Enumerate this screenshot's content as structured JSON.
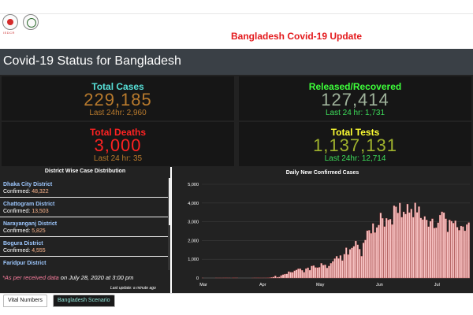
{
  "header": {
    "site_title": "Bangladesh Covid-19 Update",
    "logo_caption": "IEDCR"
  },
  "dashboard": {
    "title": "Covid-19 Status for Bangladesh"
  },
  "stats": {
    "total_cases": {
      "label": "Total Cases",
      "value": "229,185",
      "sub": "Last 24hr: 2,960",
      "label_color": "#57e0d8",
      "value_color": "#b87a2d",
      "sub_color": "#b87a2d"
    },
    "recovered": {
      "label": "Released/Recovered",
      "value": "127,414",
      "sub": "Last 24 hr: 1,731",
      "label_color": "#3dff3a",
      "value_color": "#9fb29b",
      "sub_color": "#3ddc5a"
    },
    "deaths": {
      "label": "Total Deaths",
      "value": "3,000",
      "sub": "Last 24 hr: 35",
      "label_color": "#ff2222",
      "value_color": "#ff2222",
      "sub_color": "#b87a2d"
    },
    "tests": {
      "label": "Total Tests",
      "value": "1,137,131",
      "sub": "Last 24hr: 12,714",
      "label_color": "#ffff33",
      "value_color": "#9fb22d",
      "sub_color": "#3ddc5a"
    }
  },
  "districts": {
    "title": "District Wise Case Distribution",
    "items": [
      {
        "name": "Dhaka City District",
        "confirmed_label": "Confirmed:",
        "confirmed": "48,322"
      },
      {
        "name": "Chattogram District",
        "confirmed_label": "Confirmed:",
        "confirmed": "13,503"
      },
      {
        "name": "Narayanganj District",
        "confirmed_label": "Confirmed:",
        "confirmed": "5,825"
      },
      {
        "name": "Bogura District",
        "confirmed_label": "Confirmed:",
        "confirmed": "4,555"
      },
      {
        "name": "Faridpur District",
        "confirmed_label": "",
        "confirmed": ""
      }
    ],
    "footnote_lead": "*As per received data",
    "footnote_rest": " on July 28, 2020 at 3:00 pm",
    "last_update": "Last update: a minute ago"
  },
  "tabs": {
    "vital": "Vital Numbers",
    "scenario": "Bangladesh Scenario"
  },
  "colors": {
    "bar_fill": "#f7c4c4",
    "bar_stroke": "#b03030"
  },
  "chart_data": {
    "type": "bar",
    "title": "Daily New Confirmed Cases",
    "xlabel": "",
    "ylabel": "",
    "ylim": [
      0,
      5000
    ],
    "yticks": [
      0,
      1000,
      2000,
      3000,
      4000,
      5000
    ],
    "ytick_labels": [
      "0",
      "1,000",
      "2,000",
      "3,000",
      "4,000",
      "5,000"
    ],
    "xtick_labels": [
      "Mar",
      "Apr",
      "May",
      "Jun",
      "Jul"
    ],
    "xtick_days": [
      0,
      31,
      61,
      92,
      122
    ],
    "x_start": "2020-03-08",
    "values": [
      3,
      0,
      0,
      0,
      0,
      0,
      0,
      3,
      2,
      2,
      1,
      3,
      6,
      3,
      3,
      0,
      6,
      4,
      5,
      0,
      0,
      0,
      0,
      0,
      0,
      0,
      1,
      4,
      3,
      6,
      2,
      2,
      3,
      3,
      9,
      18,
      35,
      54,
      112,
      41,
      58,
      139,
      182,
      209,
      219,
      341,
      312,
      306,
      390,
      434,
      492,
      497,
      414,
      309,
      503,
      549,
      418,
      641,
      665,
      564,
      552,
      571,
      786,
      688,
      706,
      539,
      641,
      790,
      887,
      1034,
      1162,
      1041,
      1202,
      930,
      1273,
      1617,
      1251,
      1532,
      1606,
      1694,
      1975,
      1773,
      1541,
      1166,
      1873,
      2029,
      2523,
      2545,
      2381,
      2911,
      2423,
      2695,
      2828,
      3471,
      3187,
      2743,
      3190,
      3099,
      3141,
      2856,
      3862,
      3803,
      3471,
      4008,
      3243,
      3531,
      3412,
      3946,
      3489,
      3682,
      3240,
      4014,
      3504,
      3809,
      3201,
      3114,
      3288,
      3099,
      2738,
      3027,
      3163,
      2666,
      2686,
      2949,
      3360,
      3533,
      3489,
      3163,
      2459,
      3099,
      3034,
      2928,
      3057,
      2711,
      2548,
      2772,
      2744,
      2520,
      2856,
      2960
    ],
    "bar_label": "daily new cases"
  }
}
